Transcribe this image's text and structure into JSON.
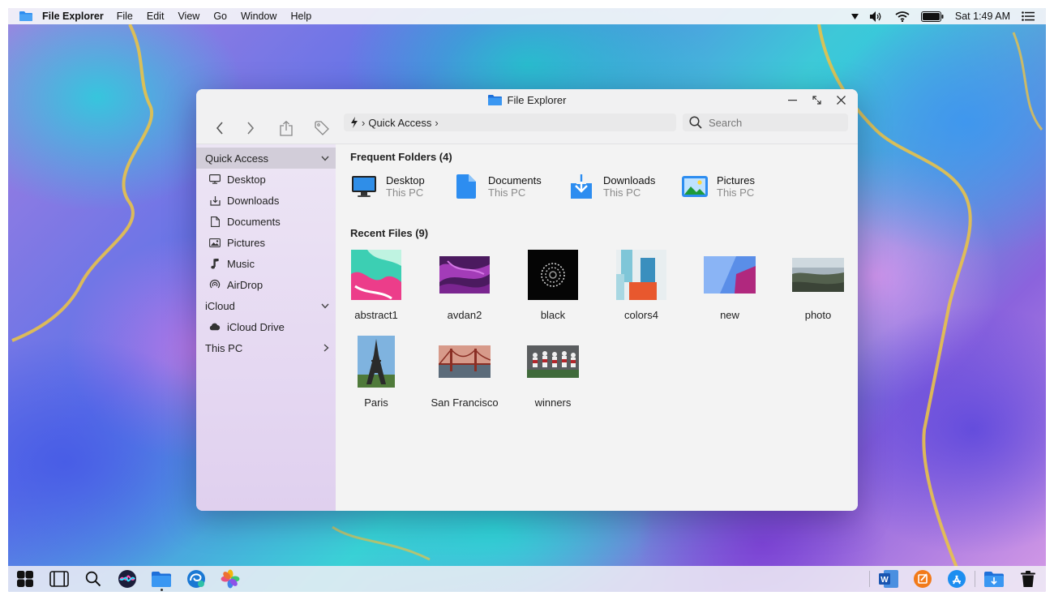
{
  "menubar": {
    "app_name": "File Explorer",
    "menus": [
      "File",
      "Edit",
      "View",
      "Go",
      "Window",
      "Help"
    ],
    "clock": "Sat 1:49 AM",
    "status_icons": [
      "dropdown-arrow-icon",
      "volume-icon",
      "wifi-icon",
      "battery-icon",
      "list-icon"
    ]
  },
  "window": {
    "title": "File Explorer",
    "address": {
      "root_icon": "bolt-icon",
      "location": "Quick Access"
    },
    "search": {
      "placeholder": "Search"
    }
  },
  "sidebar": {
    "quick_access": {
      "label": "Quick Access",
      "items": [
        {
          "label": "Desktop",
          "icon": "monitor-icon"
        },
        {
          "label": "Downloads",
          "icon": "download-icon"
        },
        {
          "label": "Documents",
          "icon": "document-icon"
        },
        {
          "label": "Pictures",
          "icon": "picture-icon"
        },
        {
          "label": "Music",
          "icon": "music-icon"
        },
        {
          "label": "AirDrop",
          "icon": "airdrop-icon"
        }
      ]
    },
    "icloud": {
      "label": "iCloud",
      "items": [
        {
          "label": "iCloud Drive",
          "icon": "cloud-icon"
        }
      ]
    },
    "this_pc": {
      "label": "This PC"
    }
  },
  "main": {
    "frequent_title": "Frequent Folders (4)",
    "frequent": [
      {
        "name": "Desktop",
        "location": "This PC",
        "icon": "desktop-folder-icon"
      },
      {
        "name": "Documents",
        "location": "This PC",
        "icon": "documents-folder-icon"
      },
      {
        "name": "Downloads",
        "location": "This PC",
        "icon": "downloads-folder-icon"
      },
      {
        "name": "Pictures",
        "location": "This PC",
        "icon": "pictures-folder-icon"
      }
    ],
    "recent_title": "Recent Files (9)",
    "recent": [
      {
        "name": "abstract1"
      },
      {
        "name": "avdan2"
      },
      {
        "name": "black"
      },
      {
        "name": "colors4"
      },
      {
        "name": "new"
      },
      {
        "name": "photo"
      },
      {
        "name": "Paris"
      },
      {
        "name": "San Francisco"
      },
      {
        "name": "winners"
      }
    ]
  },
  "dock": {
    "icons": [
      "start-icon",
      "task-view-icon",
      "search-icon",
      "siri-icon",
      "file-explorer-icon",
      "edge-icon",
      "photos-icon",
      "word-icon",
      "pages-icon",
      "app-store-icon",
      "downloads-stack-icon",
      "trash-icon"
    ]
  },
  "colors": {
    "accent": "#1e7ff0",
    "folder_blue": "#2d8df0"
  }
}
